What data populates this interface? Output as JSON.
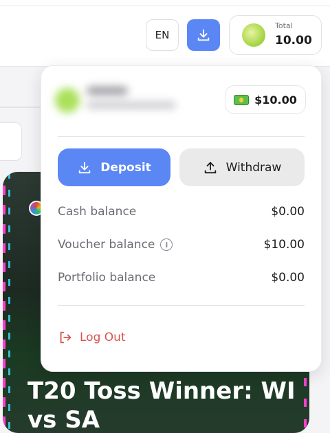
{
  "header": {
    "lang_label": "EN",
    "total_label": "Total",
    "total_value": "10.00"
  },
  "background_card": {
    "title": "T20 Toss Winner: WI vs SA"
  },
  "dropdown": {
    "balance_chip": "$10.00",
    "deposit_label": "Deposit",
    "withdraw_label": "Withdraw",
    "balances": [
      {
        "label": "Cash balance",
        "value": "$0.00"
      },
      {
        "label": "Voucher balance",
        "value": "$10.00"
      },
      {
        "label": "Portfolio balance",
        "value": "$0.00"
      }
    ],
    "logout_label": "Log Out"
  },
  "colors": {
    "accent": "#5b87f5",
    "danger": "#d9534f"
  },
  "icons": [
    "download-icon",
    "upload-icon",
    "info-icon",
    "logout-icon",
    "money-icon"
  ]
}
